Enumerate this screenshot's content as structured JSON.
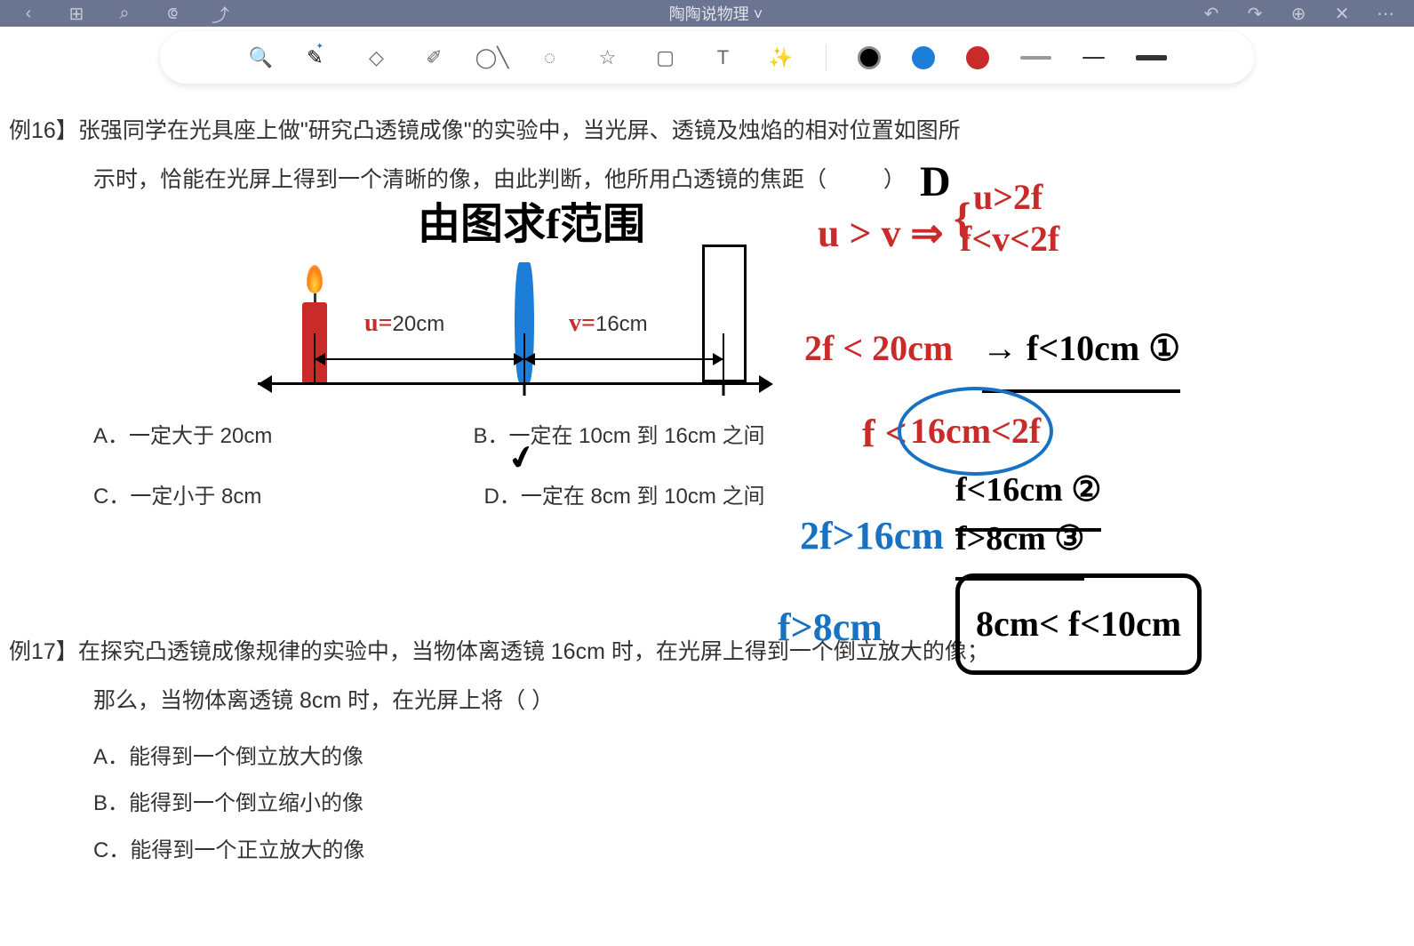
{
  "header": {
    "title": "陶陶说物理 ˅"
  },
  "toolbar": {
    "colors": {
      "black": "#000000",
      "blue": "#1c7ed6",
      "red": "#c92a2a"
    }
  },
  "problem16": {
    "label": "例16】",
    "text1": "张强同学在光具座上做\"研究凸透镜成像\"的实验中，当光屏、透镜及烛焰的相对位置如图所",
    "text2": "示时，恰能在光屏上得到一个清晰的像，由此判断，他所用凸透镜的焦距（",
    "text3": "）",
    "diagram": {
      "u_label_prefix": "u=",
      "u_value": "20cm",
      "v_label_prefix": "v=",
      "v_value": "16cm"
    },
    "options": {
      "a": "A．一定大于 20cm",
      "b": "B．一定在 10cm 到 16cm 之间",
      "c": "C．一定小于 8cm",
      "d": "D．一定在 8cm 到 10cm 之间"
    }
  },
  "problem17": {
    "label": "例17】",
    "text1": "在探究凸透镜成像规律的实验中，当物体离透镜 16cm 时，在光屏上得到一个倒立放大的像；",
    "text2": "那么，当物体离透镜 8cm 时，在光屏上将（       ）",
    "options": {
      "a": "A．能得到一个倒立放大的像",
      "b": "B．能得到一个倒立缩小的像",
      "c": "C．能得到一个正立放大的像"
    }
  },
  "annotations": {
    "title_hand": "由图求f范围",
    "answer_letter": "D",
    "line1": "u > v ⇒",
    "line1a": "u>2f",
    "line1b": "f<v<2f",
    "line2a": "2f < 20cm",
    "line2b": "→ f<10cm ①",
    "line3a": "f <",
    "line3b": "16cm<2f",
    "line4a": "f<16cm ②",
    "line5": "2f>16cm",
    "line5b": "f>8cm ③",
    "line6": "f>8cm",
    "box": "8cm< f<10cm",
    "check_d": "✔"
  }
}
